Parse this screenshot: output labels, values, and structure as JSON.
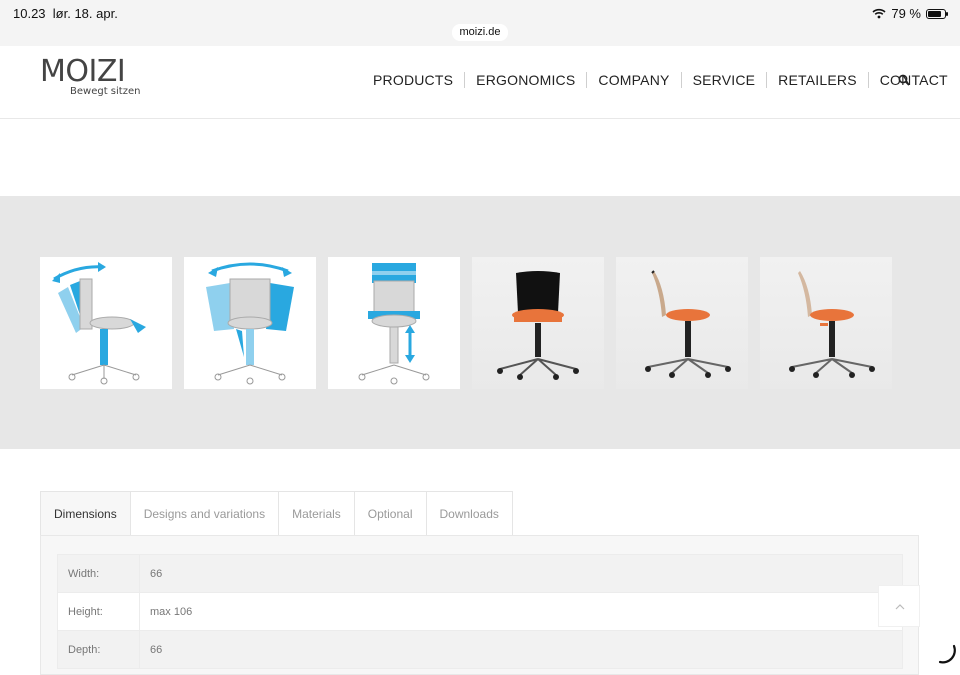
{
  "status": {
    "time": "10.23",
    "date": "lør. 18. apr.",
    "battery": "79 %",
    "battery_level": 0.79,
    "url": "moizi.de"
  },
  "brand": {
    "name": "MOIZI",
    "tagline": "Bewegt sitzen"
  },
  "nav": {
    "items": [
      "PRODUCTS",
      "ERGONOMICS",
      "COMPANY",
      "SERVICE",
      "RETAILERS",
      "CONTACT"
    ]
  },
  "colors": {
    "accent_blue": "#29a8e0",
    "orange": "#e8743b",
    "band_gray": "#e7e7e7"
  },
  "tabs": {
    "items": [
      "Dimensions",
      "Designs and variations",
      "Materials",
      "Optional",
      "Downloads"
    ],
    "active": 0
  },
  "dimensions": [
    {
      "label": "Width:",
      "value": "66"
    },
    {
      "label": "Height:",
      "value": "max 106"
    },
    {
      "label": "Depth:",
      "value": "66"
    }
  ]
}
